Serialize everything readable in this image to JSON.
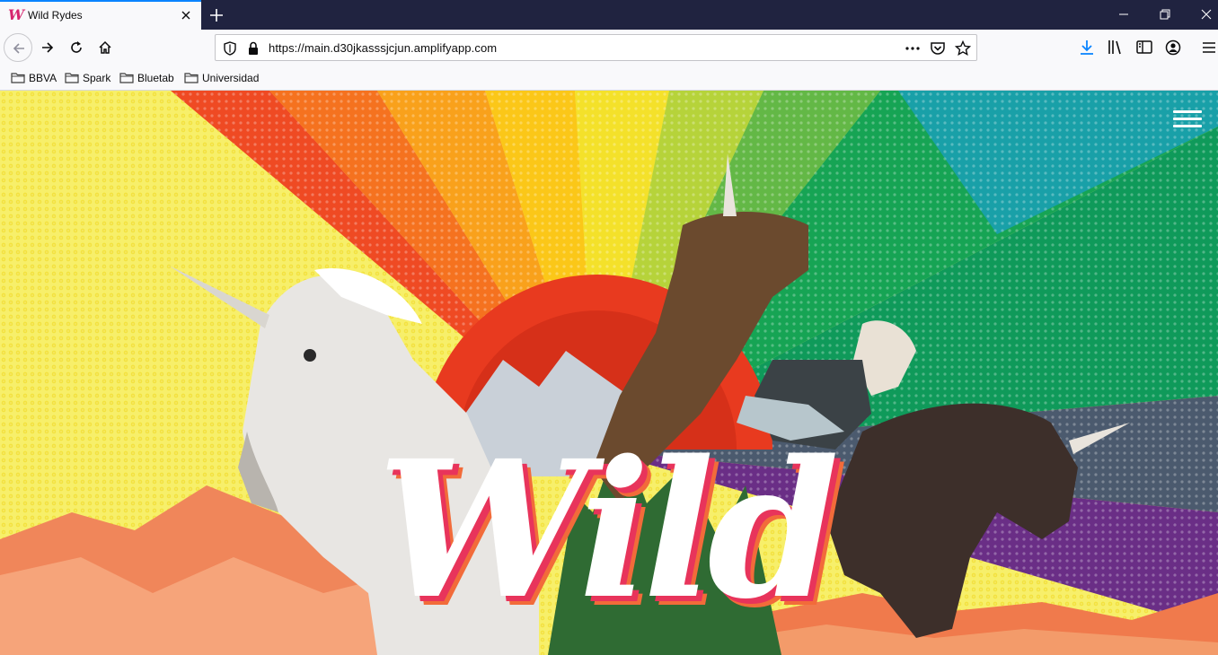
{
  "browser": {
    "tab": {
      "title": "Wild Rydes",
      "favicon": "W"
    },
    "url": "https://main.d30jkasssjcjun.amplifyapp.com",
    "bookmarks": [
      {
        "label": "BBVA"
      },
      {
        "label": "Spark"
      },
      {
        "label": "Bluetab"
      },
      {
        "label": "Universidad"
      }
    ],
    "icons": [
      "back-icon",
      "forward-icon",
      "reload-icon",
      "home-icon",
      "shield-icon",
      "lock-icon",
      "more-icon",
      "pocket-icon",
      "star-icon",
      "download-icon",
      "library-icon",
      "sidebar-icon",
      "account-icon",
      "menu-icon"
    ]
  },
  "page": {
    "hero_title": "Wild",
    "colors": {
      "accent": "#e8345b",
      "title_shadow": "#f26b3a"
    }
  }
}
